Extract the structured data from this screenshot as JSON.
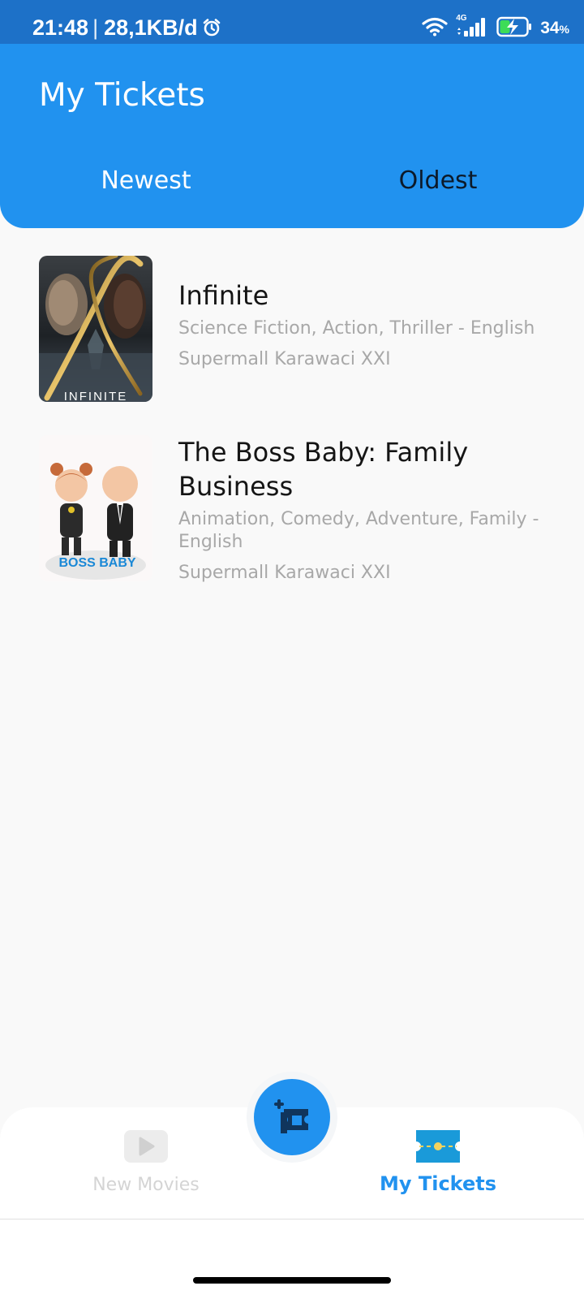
{
  "status_bar": {
    "time": "21:48",
    "separator": "|",
    "data_rate": "28,1KB/d",
    "network_label": "4G",
    "battery_percent": "34",
    "battery_unit": "%",
    "icons": [
      "alarm-icon",
      "wifi-icon",
      "signal-icon",
      "battery-charging-icon"
    ]
  },
  "header": {
    "title": "My Tickets",
    "background_color": "#2192ef",
    "tabs": [
      {
        "label": "Newest",
        "active": true
      },
      {
        "label": "Oldest",
        "active": false
      }
    ]
  },
  "tickets": [
    {
      "title": "Infinite",
      "genre": "Science Fiction, Action, Thriller - English",
      "cinema": "Supermall Karawaci XXI",
      "poster_text": "INFINITE"
    },
    {
      "title": "The Boss Baby: Family Business",
      "genre": "Animation, Comedy, Adventure, Family - English",
      "cinema": "Supermall Karawaci XXI",
      "poster_text": "BOSS BABY"
    }
  ],
  "bottom_nav": {
    "items": [
      {
        "label": "New Movies",
        "icon": "play-icon",
        "active": false
      },
      {
        "label": "My Tickets",
        "icon": "ticket-icon",
        "active": true
      }
    ],
    "fab_icon": "add-ticket-icon",
    "active_color": "#2192ef",
    "inactive_color": "#d4d4d4"
  }
}
